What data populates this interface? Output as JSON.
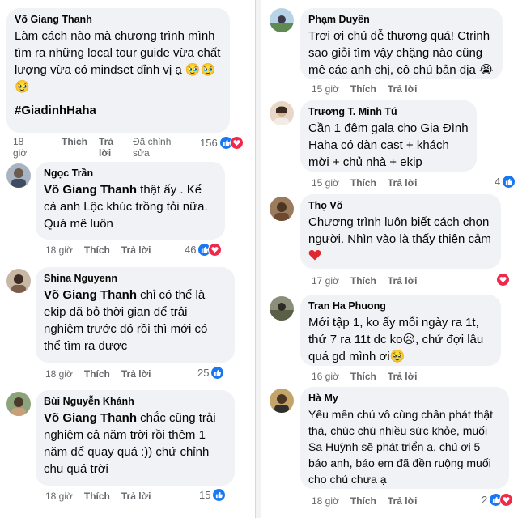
{
  "left": [
    {
      "author": "Võ Giang Thanh",
      "text": "Làm cách nào mà chương trình mình tìm ra những local tour guide vừa chất lượng vừa có mindset đỉnh vị ạ 🥹🥹🥹",
      "hashtag": "#GiadinhHaha",
      "time": "18 giờ",
      "like_label": "Thích",
      "reply_label": "Trả lời",
      "edited_label": "Đã chỉnh sửa",
      "reactions": "156"
    },
    {
      "author": "Ngọc Trần",
      "mention": "Võ Giang Thanh",
      "text": " thật ấy . Kể cả anh Lộc khúc trồng tỏi nữa. Quá mê luôn",
      "time": "18 giờ",
      "like_label": "Thích",
      "reply_label": "Trả lời",
      "reactions": "46"
    },
    {
      "author": "Shina Nguyenn",
      "mention": "Võ Giang Thanh",
      "text": " chỉ có thể là ekip đã bỏ thời gian để trải nghiệm trước đó rồi thì mới có thể tìm ra được",
      "time": "18 giờ",
      "like_label": "Thích",
      "reply_label": "Trả lời",
      "reactions": "25"
    },
    {
      "author": "Bùi Nguyễn Khánh",
      "mention": "Võ Giang Thanh",
      "text": " chắc cũng trải nghiệm cả năm trời rồi thêm 1 năm để quay quá :)) chứ chỉnh chu quá trời",
      "time": "18 giờ",
      "like_label": "Thích",
      "reply_label": "Trả lời",
      "reactions": "15"
    }
  ],
  "right": [
    {
      "author": "Phạm Duyên",
      "text": "Trơi ơi chú dễ thương quá! Ctrinh sao giỏi tìm vậy chặng nào cũng mê các anh chị, cô chú bản địa 😭",
      "time": "15 giờ",
      "like_label": "Thích",
      "reply_label": "Trả lời"
    },
    {
      "author": "Trương T. Minh Tú",
      "text": "Cần 1 đêm gala cho Gia Đình Haha có dàn cast + khách mời + chủ nhà + ekip",
      "time": "15 giờ",
      "like_label": "Thích",
      "reply_label": "Trả lời",
      "reactions": "4"
    },
    {
      "author": "Thọ Võ",
      "text": "Chương trình luôn biết cách chọn người. Nhìn vào là thấy thiện cảm",
      "time": "17 giờ",
      "like_label": "Thích",
      "reply_label": "Trả lời"
    },
    {
      "author": "Tran Ha Phuong",
      "text": "Mới tập 1, ko ấy mỗi ngày ra 1t, thứ 7 ra 11t dc ko😥, chứ đợi lâu quá gd mình ơi🥹",
      "time": "16 giờ",
      "like_label": "Thích",
      "reply_label": "Trả lời"
    },
    {
      "author": "Hà My",
      "text": "Yêu mến chú vô cùng chân phát thật thà, chúc chú nhiều sức khỏe, muối Sa Huỳnh sẽ phát triển ạ, chú ơi 5 báo anh, báo em đã đền ruộng muối cho chú chưa ạ",
      "time": "18 giờ",
      "like_label": "Thích",
      "reply_label": "Trả lời",
      "reactions": "2"
    }
  ],
  "colors": {
    "like": "#1877f2",
    "heart": "#f0284a",
    "bubble": "#f0f2f5",
    "meta": "#65676b"
  }
}
